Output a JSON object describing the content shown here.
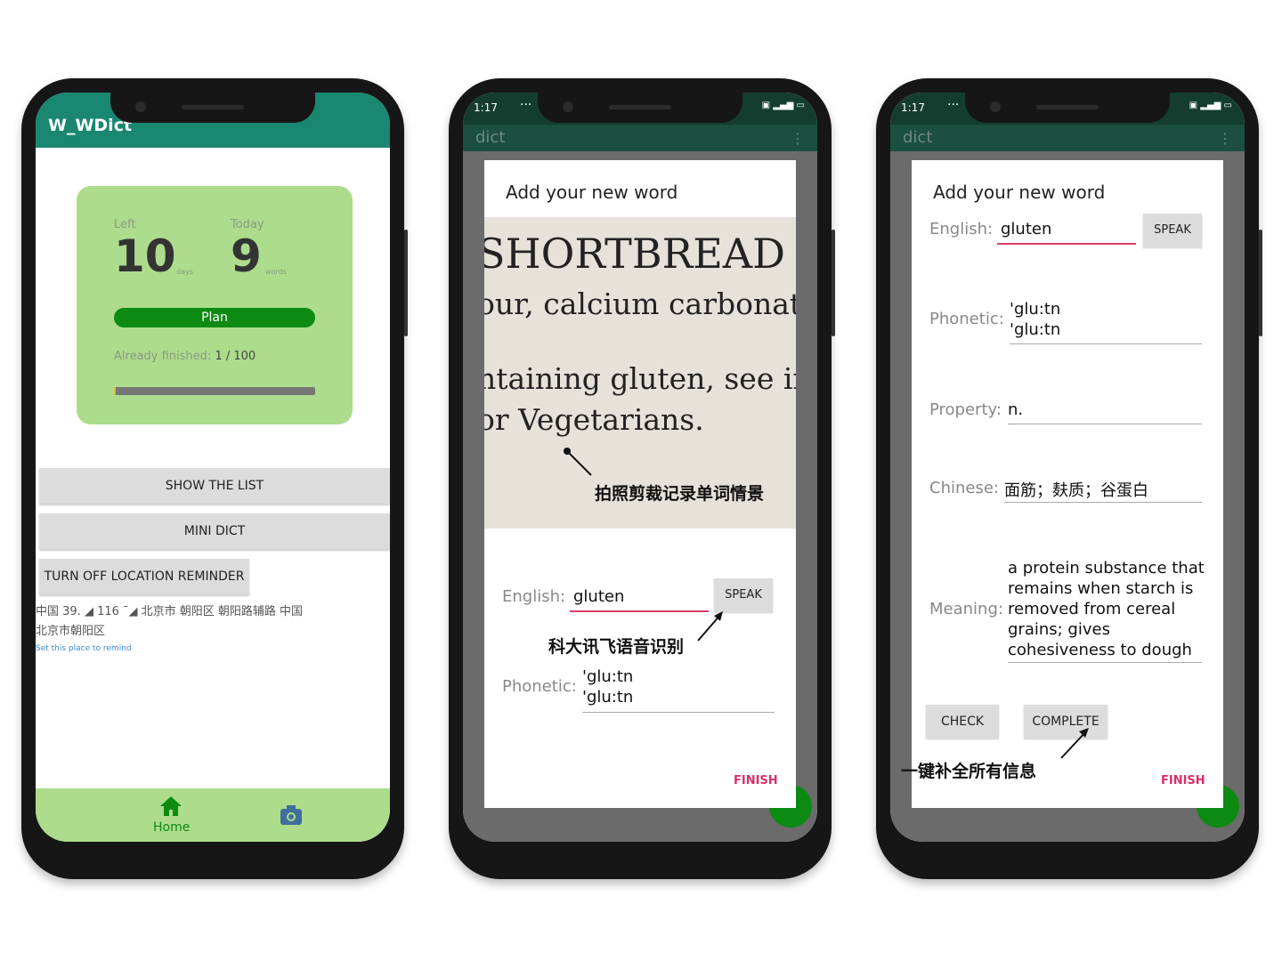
{
  "phone1": {
    "app_title": "W_WDict",
    "card": {
      "left_label": "Left",
      "left_value": "10",
      "left_unit": "days",
      "today_label": "Today",
      "today_value": "9",
      "today_unit": "words",
      "plan_button": "Plan",
      "finished_label": "Already finished:",
      "finished_value": "1 / 100",
      "progress_fraction": 0.01
    },
    "show_list_button": "SHOW THE LIST",
    "mini_dict_button": "MINI DICT",
    "location_reminder_button": "TURN OFF LOCATION REMINDER",
    "location_row1": "中国 39.   ◢     116 ˉ◢     北京市 朝阳区 朝阳路辅路 中国",
    "location_row2": "北京市朝阳区",
    "location_hint": "Set this place to remind",
    "nav": {
      "home_label": "Home",
      "home_icon": "home-icon",
      "camera_icon": "camera-icon"
    }
  },
  "phone2": {
    "status_time": "1:17",
    "status_dots": "···",
    "app_title": "dict",
    "dialog_title": "Add your new word",
    "photo_lines": [
      "SHORTBREAD",
      "our, calcium carbonate,",
      "ntaining gluten, see ing",
      "or Vegetarians."
    ],
    "photo_annotation": "拍照剪裁记录单词情景",
    "english_label": "English:",
    "english_value": "gluten",
    "speak_button": "SPEAK",
    "voice_annotation": "科大讯飞语音识别",
    "phonetic_label": "Phonetic:",
    "phonetic_line1": "'glu:tn",
    "phonetic_line2": "'glu:tn",
    "finish_button": "FINISH"
  },
  "phone3": {
    "status_time": "1:17",
    "status_dots": "···",
    "app_title": "dict",
    "dialog_title": "Add your new word",
    "english_label": "English:",
    "english_value": "gluten",
    "speak_button": "SPEAK",
    "phonetic_label": "Phonetic:",
    "phonetic_line1": "'glu:tn",
    "phonetic_line2": "'glu:tn",
    "property_label": "Property:",
    "property_value": "n.",
    "chinese_label": "Chinese:",
    "chinese_value": "面筋；麸质；谷蛋白",
    "meaning_label": "Meaning:",
    "meaning_lines": [
      "a protein substance that",
      "remains when starch is",
      "removed from cereal",
      "grains; gives",
      "cohesiveness to dough"
    ],
    "check_button": "CHECK",
    "complete_button": "COMPLETE",
    "complete_annotation": "一键补全所有信息",
    "finish_button": "FINISH"
  },
  "colors": {
    "appbar": "#1a8770",
    "card": "#acdc8c",
    "accent_green": "#0c8a12",
    "finish_pink": "#d8306a"
  }
}
